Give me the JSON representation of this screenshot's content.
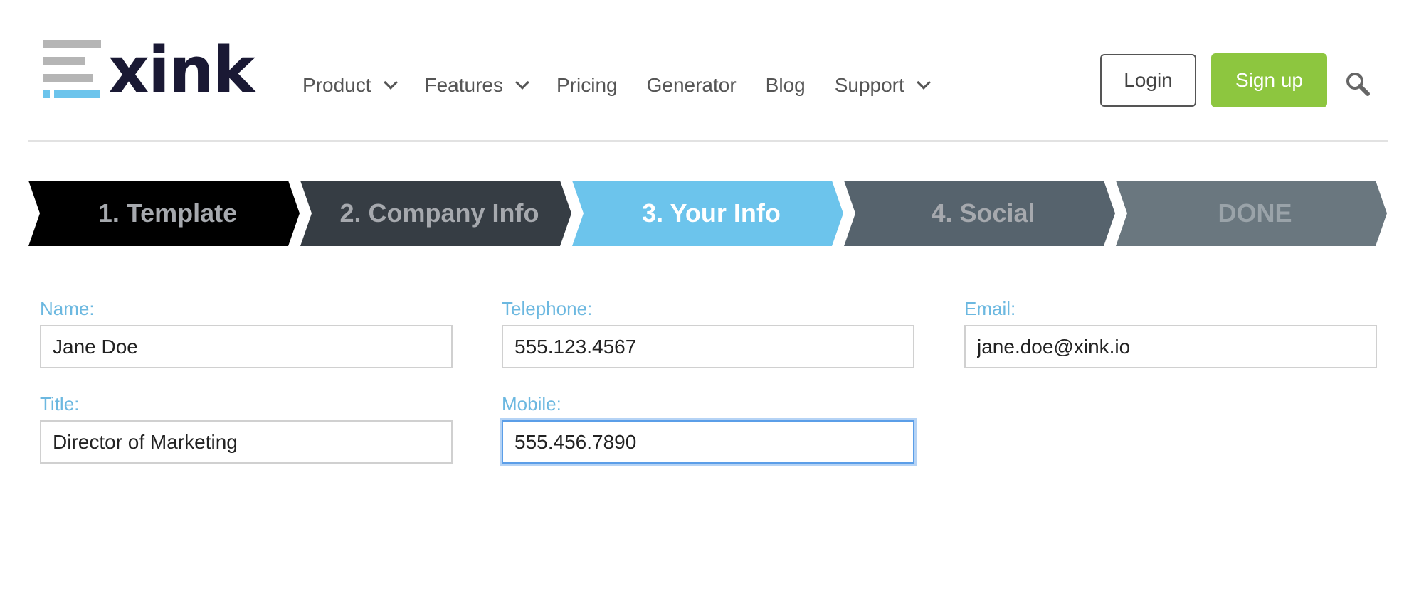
{
  "brand": {
    "name": "xink"
  },
  "nav": {
    "items": [
      {
        "label": "Product",
        "dropdown": true
      },
      {
        "label": "Features",
        "dropdown": true
      },
      {
        "label": "Pricing",
        "dropdown": false
      },
      {
        "label": "Generator",
        "dropdown": false
      },
      {
        "label": "Blog",
        "dropdown": false
      },
      {
        "label": "Support",
        "dropdown": true
      }
    ],
    "login_label": "Login",
    "signup_label": "Sign up",
    "search_icon": "search-icon"
  },
  "steps": [
    {
      "label": "1. Template",
      "bg": "#000000",
      "color": "#a6a9ae"
    },
    {
      "label": "2. Company Info",
      "bg": "#363d44",
      "color": "#a6a9ae"
    },
    {
      "label": "3. Your Info",
      "bg": "#6cc4ec",
      "color": "#ffffff",
      "active": true
    },
    {
      "label": "4. Social",
      "bg": "#56636d",
      "color": "#a6a9ae"
    },
    {
      "label": "DONE",
      "bg": "#6a777f",
      "color": "#9aa3a9"
    }
  ],
  "form": {
    "name": {
      "label": "Name:",
      "value": "Jane Doe"
    },
    "telephone": {
      "label": "Telephone:",
      "value": "555.123.4567"
    },
    "email": {
      "label": "Email:",
      "value": "jane.doe@xink.io"
    },
    "title": {
      "label": "Title:",
      "value": "Director of Marketing"
    },
    "mobile": {
      "label": "Mobile:",
      "value": "555.456.7890",
      "focused": true
    }
  },
  "colors": {
    "accent": "#6cc4ec",
    "signup": "#8dc63f",
    "logo_text": "#1a1934",
    "label": "#6cb8e0"
  }
}
